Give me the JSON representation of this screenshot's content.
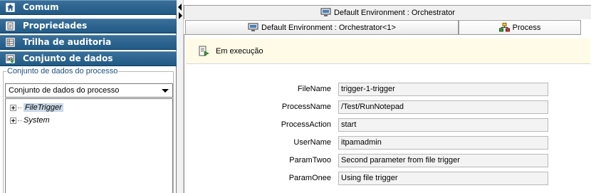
{
  "accordion": [
    {
      "label": "Comum",
      "icon": "home-icon"
    },
    {
      "label": "Propriedades",
      "icon": "document-icon"
    },
    {
      "label": "Trilha de auditoria",
      "icon": "list-icon"
    },
    {
      "label": "Conjunto de dados",
      "icon": "dataset-icon"
    }
  ],
  "dataset": {
    "legend": "Conjunto de dados do processo",
    "selected": "Conjunto de dados do processo",
    "tree": [
      {
        "label": "FileTrigger",
        "selected": true
      },
      {
        "label": "System",
        "selected": false
      }
    ]
  },
  "tabs": {
    "outer": "Default Environment : Orchestrator",
    "inner": [
      {
        "label": "Default Environment : Orchestrator<1>",
        "icon": "monitor-icon"
      },
      {
        "label": "Process",
        "icon": "process-icon"
      }
    ]
  },
  "status": {
    "text": "Em execução",
    "icon": "running-icon"
  },
  "fields": [
    {
      "label": "FileName",
      "value": "trigger-1-trigger"
    },
    {
      "label": "ProcessName",
      "value": "/Test/RunNotepad"
    },
    {
      "label": "ProcessAction",
      "value": "start"
    },
    {
      "label": "UserName",
      "value": "itpamadmin"
    },
    {
      "label": "ParamTwoo",
      "value": "Second parameter from file trigger"
    },
    {
      "label": "ParamOnee",
      "value": "Using file trigger"
    }
  ],
  "colors": {
    "accordion_header": "#205a86",
    "status_background": "#fffbe6",
    "legend_text": "#1e4f7d"
  }
}
